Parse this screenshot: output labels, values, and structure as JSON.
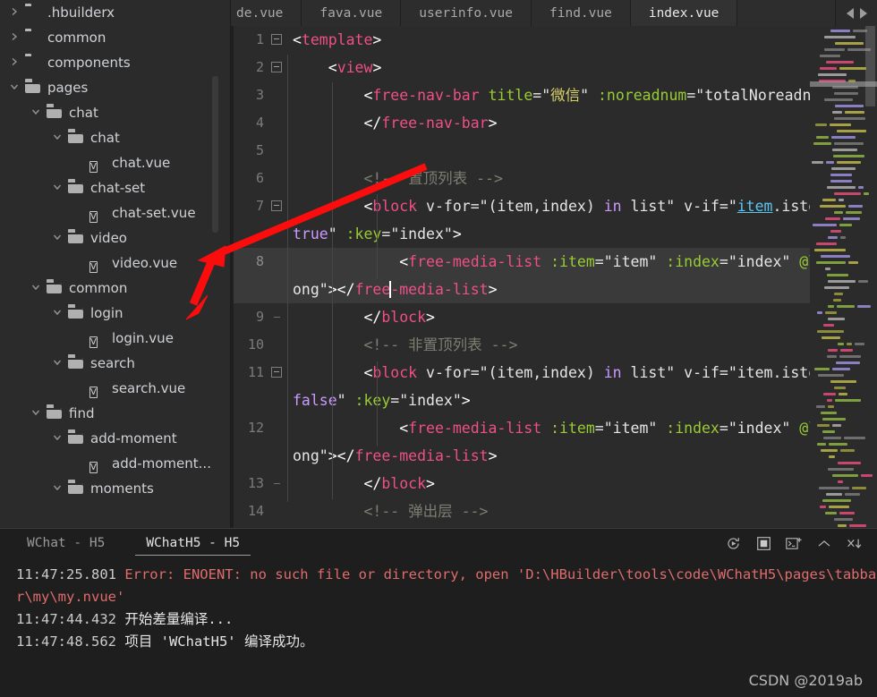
{
  "sidebar": {
    "items": [
      {
        "label": ".hbuilderx",
        "indent": 0,
        "type": "folder",
        "state": "collapsed"
      },
      {
        "label": "common",
        "indent": 0,
        "type": "folder",
        "state": "collapsed"
      },
      {
        "label": "components",
        "indent": 0,
        "type": "folder",
        "state": "collapsed"
      },
      {
        "label": "pages",
        "indent": 0,
        "type": "folder",
        "state": "expanded"
      },
      {
        "label": "chat",
        "indent": 1,
        "type": "folder",
        "state": "expanded"
      },
      {
        "label": "chat",
        "indent": 2,
        "type": "folder",
        "state": "expanded"
      },
      {
        "label": "chat.vue",
        "indent": 3,
        "type": "file",
        "state": "none"
      },
      {
        "label": "chat-set",
        "indent": 2,
        "type": "folder",
        "state": "expanded"
      },
      {
        "label": "chat-set.vue",
        "indent": 3,
        "type": "file",
        "state": "none"
      },
      {
        "label": "video",
        "indent": 2,
        "type": "folder",
        "state": "expanded"
      },
      {
        "label": "video.vue",
        "indent": 3,
        "type": "file",
        "state": "none"
      },
      {
        "label": "common",
        "indent": 1,
        "type": "folder",
        "state": "expanded"
      },
      {
        "label": "login",
        "indent": 2,
        "type": "folder",
        "state": "expanded"
      },
      {
        "label": "login.vue",
        "indent": 3,
        "type": "file",
        "state": "none"
      },
      {
        "label": "search",
        "indent": 2,
        "type": "folder",
        "state": "expanded"
      },
      {
        "label": "search.vue",
        "indent": 3,
        "type": "file",
        "state": "none"
      },
      {
        "label": "find",
        "indent": 1,
        "type": "folder",
        "state": "expanded"
      },
      {
        "label": "add-moment",
        "indent": 2,
        "type": "folder",
        "state": "expanded"
      },
      {
        "label": "add-moment...",
        "indent": 3,
        "type": "file",
        "state": "none"
      },
      {
        "label": "moments",
        "indent": 2,
        "type": "folder",
        "state": "expanded"
      }
    ]
  },
  "tabbar": {
    "tabs": [
      {
        "label": "de.vue",
        "active": false,
        "partial": true
      },
      {
        "label": "fava.vue",
        "active": false,
        "partial": false
      },
      {
        "label": "userinfo.vue",
        "active": false,
        "partial": false
      },
      {
        "label": "find.vue",
        "active": false,
        "partial": false
      },
      {
        "label": "index.vue",
        "active": true,
        "partial": false
      }
    ],
    "nav_prev": "prev-tab-arrow",
    "nav_next": "next-tab-arrow"
  },
  "editor": {
    "filename": "index.vue",
    "lines": [
      {
        "num": "1",
        "fold": "box",
        "active": false
      },
      {
        "num": "2",
        "fold": "box",
        "active": false
      },
      {
        "num": "3",
        "fold": "none",
        "active": false
      },
      {
        "num": "4",
        "fold": "none",
        "active": false
      },
      {
        "num": "5",
        "fold": "none",
        "active": false
      },
      {
        "num": "6",
        "fold": "none",
        "active": false
      },
      {
        "num": "7",
        "fold": "box",
        "active": false
      },
      {
        "num": "8",
        "fold": "none",
        "active": true
      },
      {
        "num": "9",
        "fold": "tick",
        "active": false
      },
      {
        "num": "10",
        "fold": "none",
        "active": false
      },
      {
        "num": "11",
        "fold": "box",
        "active": false
      },
      {
        "num": "12",
        "fold": "none",
        "active": false
      },
      {
        "num": "13",
        "fold": "tick",
        "active": false
      },
      {
        "num": "14",
        "fold": "none",
        "active": false
      }
    ],
    "text": {
      "l1": "<template>",
      "l2": "<view>",
      "l3": "<free-nav-bar title=\"微信\" :noreadnum=\"totalNoreadnum\">",
      "l3_title_value": "微信",
      "l4": "</free-nav-bar>",
      "l5": "",
      "l6": "<!-- 置顶列表 -->",
      "l7": "<block v-for=\"(item,index) in list\" v-if=\"item.istop === true\" :key=\"index\">",
      "l8": "<free-media-list :item=\"item\" :index=\"index\" @long=\"long\"></free-media-list>",
      "l9": "</block>",
      "l10": "<!-- 非置顶列表 -->",
      "l11": "<block v-for=\"(item,index) in list\" v-if=\"item.istop === false\" :key=\"index\">",
      "l12": "<free-media-list :item=\"item\" :index=\"index\" @long=\"long\"></free-media-list>",
      "l13": "</block>",
      "l14": "<!-- 弹出层 -->"
    }
  },
  "console": {
    "tabs": [
      {
        "label": "WChat - H5",
        "active": false
      },
      {
        "label": "WChatH5 - H5",
        "active": true
      }
    ],
    "tools": [
      {
        "name": "restart-icon",
        "title": "restart"
      },
      {
        "name": "stop-icon",
        "title": "stop"
      },
      {
        "name": "new-terminal-icon",
        "title": "new terminal"
      },
      {
        "name": "collapse-icon",
        "title": "collapse"
      },
      {
        "name": "clear-all-icon",
        "title": "clear"
      }
    ],
    "log": [
      {
        "time": "11:47:25.801",
        "level": "error",
        "text": " Error: ENOENT: no such file or directory, open 'D:\\HBuilder\\tools\\code\\WChatH5\\pages\\tabbar\\my\\my.nvue'"
      },
      {
        "time": "11:47:44.432",
        "level": "info",
        "text": " 开始差量编译..."
      },
      {
        "time": "11:47:48.562",
        "level": "info",
        "text": " 项目 'WChatH5' 编译成功。"
      }
    ]
  },
  "watermark": "CSDN @2019ab",
  "colors": {
    "background": "#2b2b2b",
    "console_background": "#1e1e1e",
    "tag": "#ef4f88",
    "attr": "#99cc33",
    "string": "#ffffff",
    "keyword": "#cc99ff",
    "comment": "#7d7d72",
    "cn_string": "#d6cf6a",
    "link": "#5dc6f0",
    "error": "#e06c6c",
    "arrow": "#fb0d0d",
    "active_line": "#3a3a3a"
  }
}
